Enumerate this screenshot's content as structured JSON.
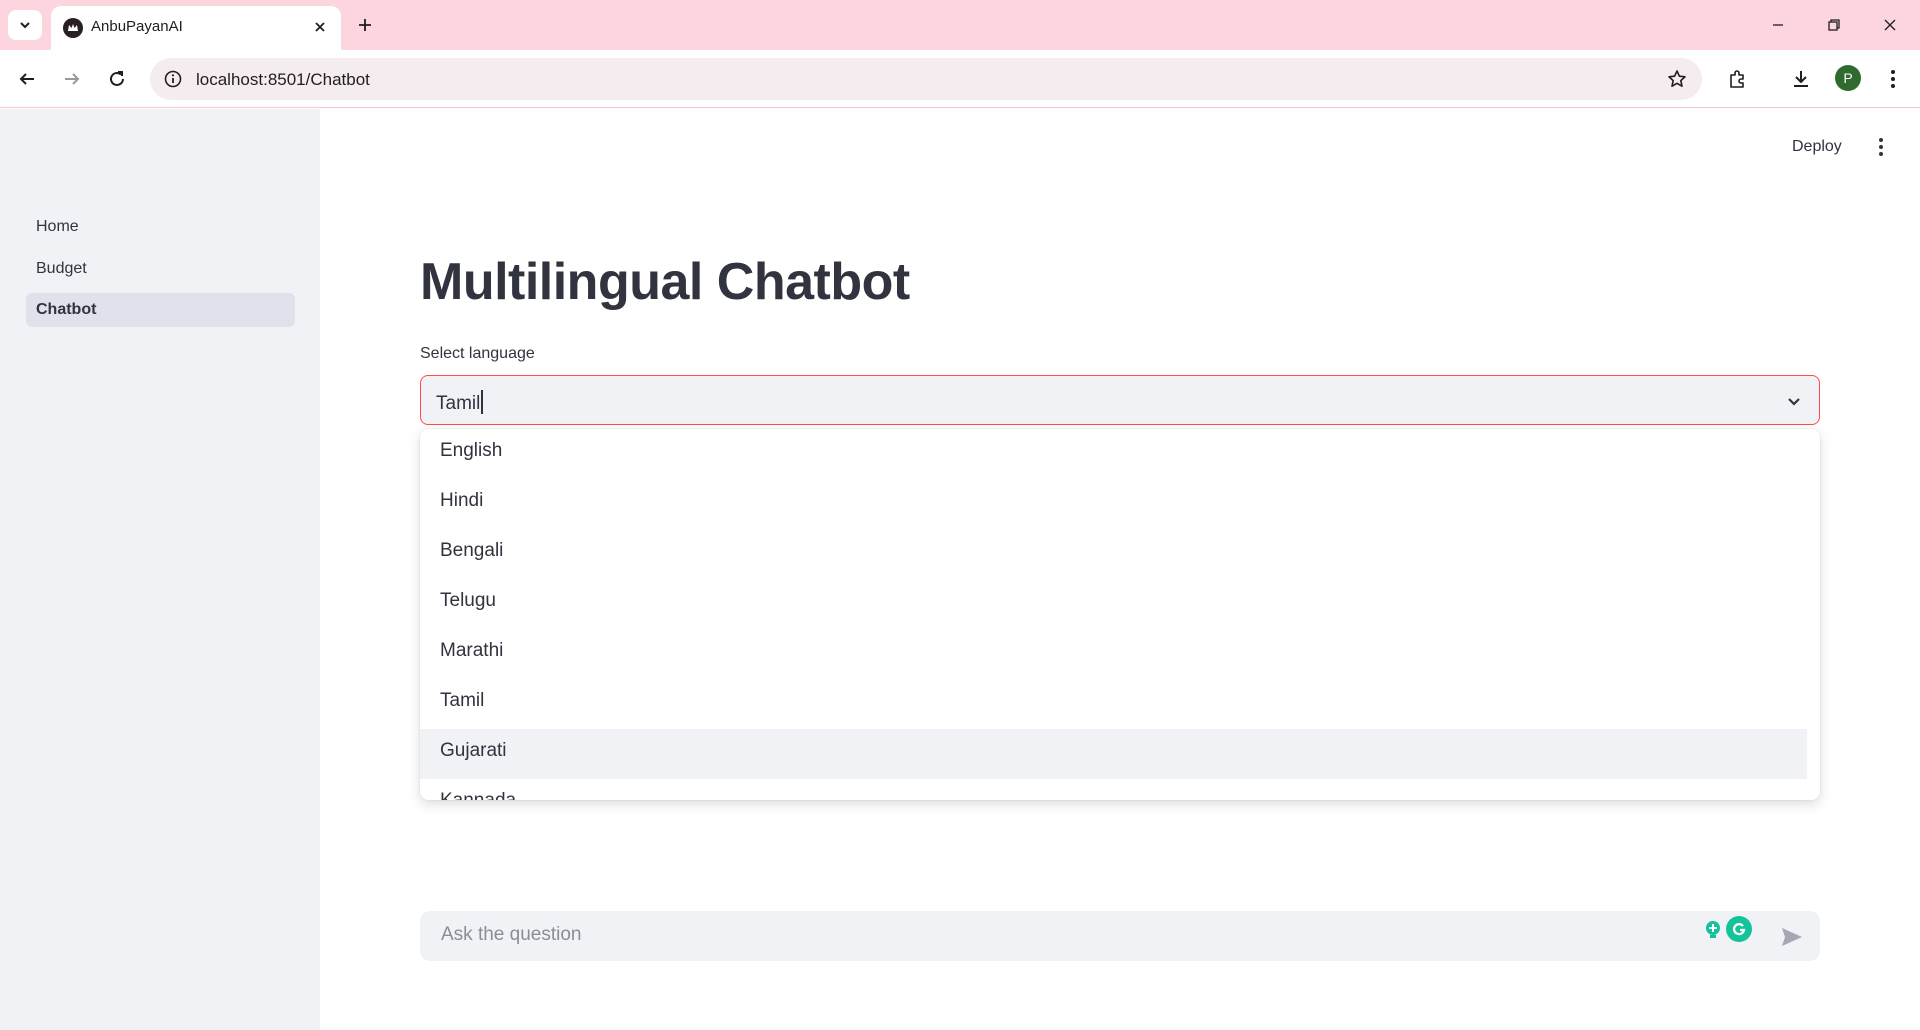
{
  "browser": {
    "tab_title": "AnbuPayanAI",
    "url": "localhost:8501/Chatbot",
    "profile_initial": "P"
  },
  "sidebar": {
    "items": [
      {
        "label": "Home",
        "active": false
      },
      {
        "label": "Budget",
        "active": false
      },
      {
        "label": "Chatbot",
        "active": true
      }
    ]
  },
  "header": {
    "deploy_label": "Deploy"
  },
  "main": {
    "title": "Multilingual Chatbot",
    "select_label": "Select language",
    "select_value": "Tamil",
    "options": [
      "English",
      "Hindi",
      "Bengali",
      "Telugu",
      "Marathi",
      "Tamil",
      "Gujarati",
      "Kannada"
    ],
    "hovered_option": "Gujarati"
  },
  "chat": {
    "placeholder": "Ask the question"
  },
  "colors": {
    "accent": "#ff4b4b",
    "sidebar_bg": "#f0f2f6",
    "chrome_bg": "#fcd5de",
    "text": "#31333f"
  }
}
